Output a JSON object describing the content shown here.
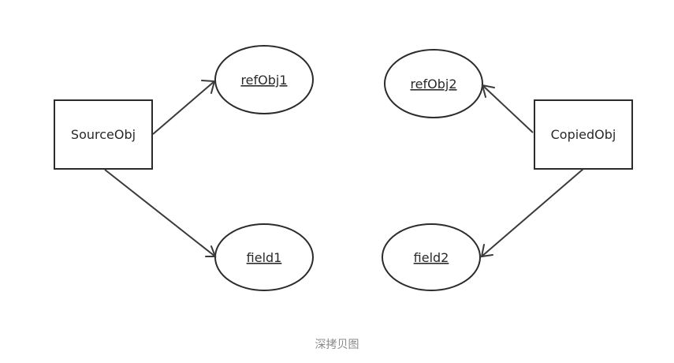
{
  "diagram": {
    "nodes": {
      "source_obj": "SourceObj",
      "copied_obj": "CopiedObj",
      "ref_obj1": "refObj1",
      "field1": "field1",
      "ref_obj2": "refObj2",
      "field2": "field2"
    },
    "colors": {
      "stroke": "#2b2b2b",
      "text": "#2a2a2a",
      "caption": "#8a8a8a"
    }
  },
  "caption": "深拷贝图"
}
